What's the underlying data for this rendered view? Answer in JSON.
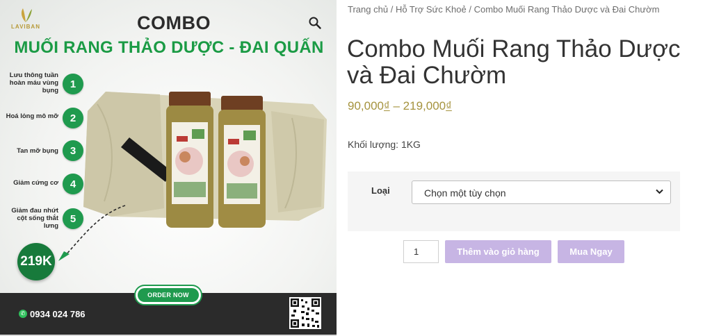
{
  "product_image": {
    "logo_text": "LAVIBAN",
    "heading": "COMBO",
    "subheading": "MUỐI RANG THẢO DƯỢC - ĐAI QUẤN",
    "benefits": [
      {
        "text": "Lưu thông tuần hoàn máu vùng bụng",
        "num": "1"
      },
      {
        "text": "Hoá lỏng mô mỡ",
        "num": "2"
      },
      {
        "text": "Tan mỡ bụng",
        "num": "3"
      },
      {
        "text": "Giảm cứng cơ",
        "num": "4"
      },
      {
        "text": "Giảm đau nhứt cột sống thắt lưng",
        "num": "5"
      }
    ],
    "price_badge": "219K",
    "order_button": "ORDER NOW",
    "phone": "0934 024 786",
    "zoom_icon": "magnifier-icon",
    "colors": {
      "brand_green": "#1f9a4e",
      "footer": "#2b2b2b"
    }
  },
  "breadcrumb": {
    "home": "Trang chủ",
    "category": "Hỗ Trợ Sức Khoẻ",
    "current": "Combo Muối Rang Thảo Dược và Đai Chườm",
    "separator": "/"
  },
  "product": {
    "title": "Combo Muối Rang Thảo Dược và Đai Chườm",
    "price_min": "90,000",
    "price_max": "219,000",
    "currency": "₫",
    "price_separator": "–",
    "weight_label": "Khối lượng:",
    "weight_value": "1KG",
    "price_color": "#a5933e"
  },
  "variations": {
    "label": "Loại",
    "select_placeholder": "Chọn một tùy chọn"
  },
  "cart": {
    "quantity": "1",
    "add_to_cart_label": "Thêm vào giỏ hàng",
    "buy_now_label": "Mua Ngay",
    "button_color": "#c7b5e4"
  }
}
